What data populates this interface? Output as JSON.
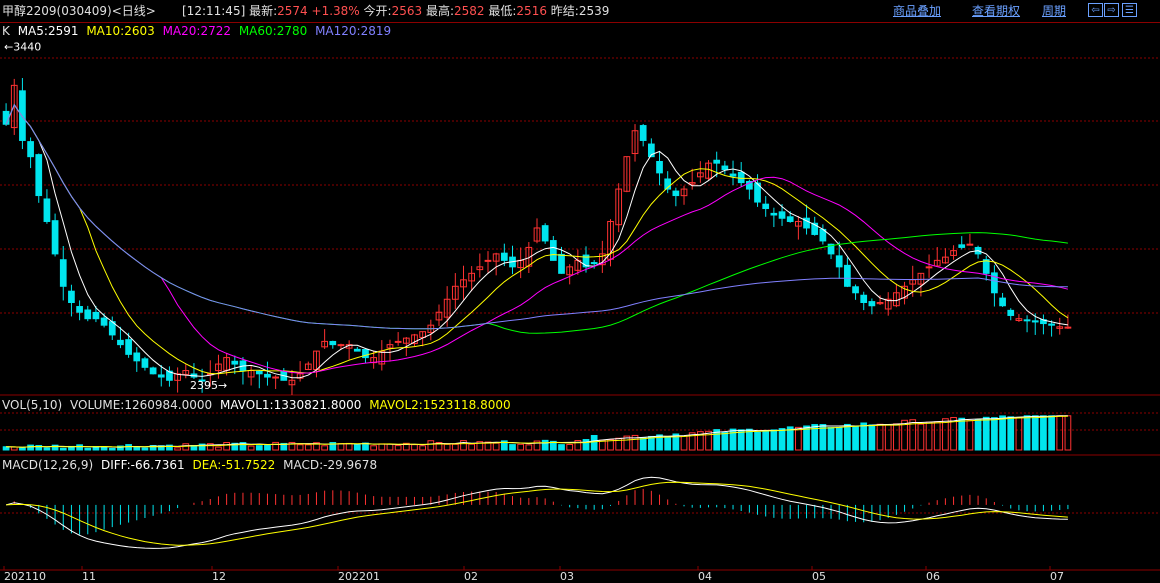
{
  "header": {
    "title": "甲醇2209(030409)<日线>",
    "time": "[12:11:45]",
    "latest_label": "最新:",
    "latest": "2574",
    "change": "+1.38%",
    "open_label": "今开:",
    "open": "2563",
    "high_label": "最高:",
    "high": "2582",
    "low_label": "最低:",
    "low": "2516",
    "prevsettle_label": "昨结:",
    "prevsettle": "2539",
    "links": [
      "商品叠加",
      "查看期权",
      "周期"
    ],
    "nav_buttons": [
      "⇦",
      "⇨",
      "☰"
    ]
  },
  "colors": {
    "up": "#ff3232",
    "down": "#00e5ee",
    "ma5": "#ffffff",
    "ma10": "#ffff00",
    "ma20": "#ff00ff",
    "ma60": "#00ff00",
    "ma120": "#8080ff",
    "grid": "#8b0000",
    "macd_diff": "#ffffff",
    "macd_dea": "#ffff00"
  },
  "k_legend": {
    "label": "K",
    "ma5": "MA5:2591",
    "ma10": "MA10:2603",
    "ma20": "MA20:2722",
    "ma60": "MA60:2780",
    "ma120": "MA120:2819"
  },
  "vol_legend": {
    "label": "VOL(5,10)",
    "volume": "VOLUME:1260984.0000",
    "mavol1": "MAVOL1:1330821.8000",
    "mavol2": "MAVOL2:1523118.8000"
  },
  "macd_legend": {
    "label": "MACD(12,26,9)",
    "diff": "DIFF:-66.7361",
    "dea": "DEA:-51.7522",
    "macd": "MACD:-29.9678"
  },
  "chart_data": {
    "type": "candlestick",
    "x_ticks": [
      "202110",
      "11",
      "12",
      "202201",
      "02",
      "03",
      "04",
      "05",
      "06",
      "07"
    ],
    "price_range": [
      2380,
      3460
    ],
    "annotations": {
      "high": {
        "label": "←3440",
        "value": 3440
      },
      "low": {
        "label": "2395→",
        "value": 2395
      }
    },
    "closes": [
      3200,
      3320,
      3150,
      3100,
      2980,
      2900,
      2800,
      2700,
      2650,
      2620,
      2600,
      2600,
      2580,
      2550,
      2520,
      2490,
      2470,
      2450,
      2430,
      2420,
      2410,
      2430,
      2440,
      2420,
      2410,
      2430,
      2460,
      2480,
      2460,
      2440,
      2440,
      2430,
      2420,
      2420,
      2410,
      2410,
      2430,
      2460,
      2500,
      2530,
      2520,
      2520,
      2520,
      2500,
      2480,
      2480,
      2500,
      2520,
      2530,
      2540,
      2550,
      2560,
      2580,
      2620,
      2660,
      2700,
      2720,
      2740,
      2760,
      2780,
      2800,
      2780,
      2760,
      2780,
      2820,
      2880,
      2840,
      2780,
      2740,
      2760,
      2780,
      2760,
      2770,
      2800,
      2900,
      3000,
      3100,
      3180,
      3150,
      3100,
      3050,
      3000,
      2980,
      3000,
      3020,
      3050,
      3080,
      3080,
      3060,
      3040,
      3020,
      3000,
      2960,
      2940,
      2920,
      2910,
      2900,
      2900,
      2880,
      2860,
      2840,
      2800,
      2760,
      2700,
      2680,
      2650,
      2640,
      2650,
      2660,
      2680,
      2700,
      2720,
      2740,
      2760,
      2780,
      2790,
      2810,
      2820,
      2830,
      2800,
      2740,
      2680,
      2640,
      2610,
      2600,
      2595,
      2590,
      2585,
      2580,
      2575,
      2574
    ],
    "volume_ma_max": 1600000,
    "macd_range": [
      -260,
      140
    ]
  }
}
